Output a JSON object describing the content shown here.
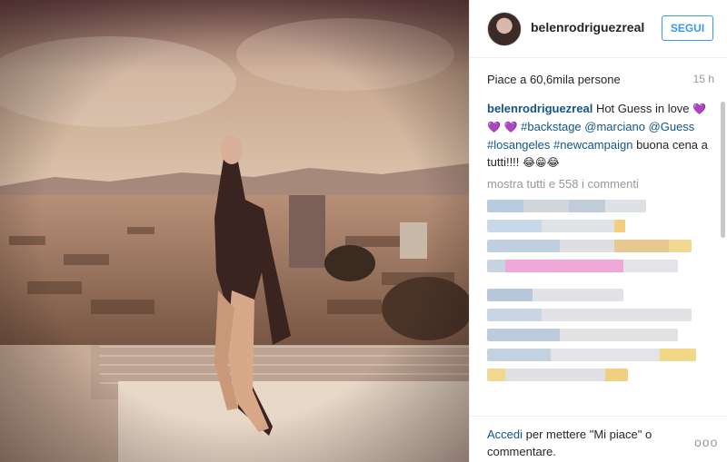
{
  "post": {
    "username": "belenrodriguezreal",
    "follow_label": "SEGUI",
    "likes": "Piace a 60,6mila persone",
    "time": "15 h"
  },
  "caption": {
    "author": "belenrodriguezreal",
    "text1": "Hot Guess in love",
    "tags1": "#backstage @marciano @Guess",
    "tags2": "#losangeles #newcampaign",
    "text2": "buona cena a tutti!!!!",
    "heart": "💜",
    "emojis": "😂😁😂"
  },
  "comments": {
    "show_all": "mostra tutti e 558 i commenti"
  },
  "footer": {
    "login_link": "Accedi",
    "login_rest": "per mettere \"Mi piace\" o commentare.",
    "more_icon": "ooo"
  },
  "colors": {
    "link": "#125688",
    "button": "#3897f0"
  }
}
